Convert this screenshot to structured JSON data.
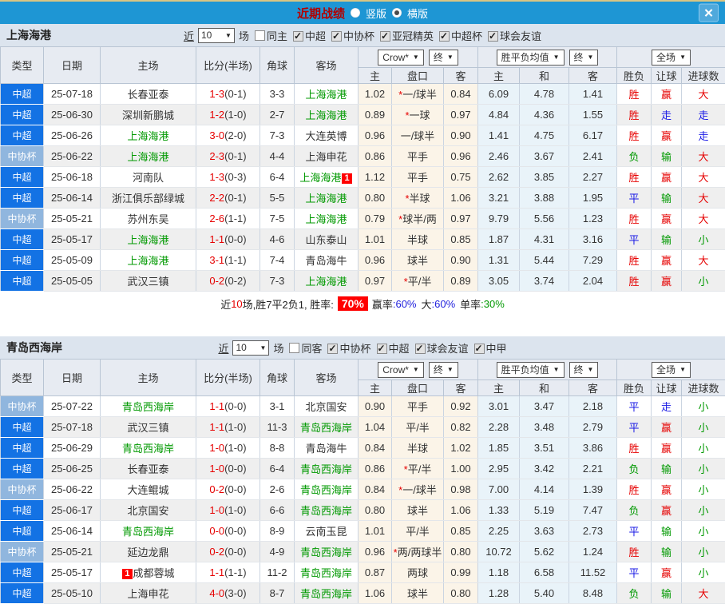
{
  "titlebar": {
    "title": "近期战绩",
    "view_options": [
      {
        "label": "竖版",
        "checked": false
      },
      {
        "label": "横版",
        "checked": true
      }
    ],
    "close_label": "✕"
  },
  "colors": {
    "titlebar_bg": "#1E96D4",
    "league_super_bg": "#1372E4",
    "league_cup_bg": "#90B6DE",
    "win_red": "#E60000",
    "draw_blue": "#1A1AE6",
    "lose_green": "#009900",
    "odds_col_bg": "#FBF4E8",
    "avg_col_bg": "#E9F3F9"
  },
  "header": {
    "columns": {
      "type": "类型",
      "date": "日期",
      "home": "主场",
      "score": "比分(半场)",
      "corner": "角球",
      "away": "客场"
    },
    "dropdowns": {
      "odds_company": "Crow*",
      "odds_final": "终",
      "avg": "胜平负均值",
      "avg_final": "终",
      "fulltime": "全场"
    },
    "sub": {
      "odds_home": "主",
      "handicap": "盘口",
      "odds_away": "客",
      "avg_home": "主",
      "avg_draw": "和",
      "avg_away": "客",
      "result": "胜负",
      "handicap_result": "让球",
      "goals": "进球数"
    }
  },
  "sections": [
    {
      "team": "上海海港",
      "filter": {
        "near": "近",
        "count": "10",
        "unit": "场",
        "same_label": "同主",
        "same_checked": false,
        "leagues": [
          {
            "label": "中超",
            "checked": true
          },
          {
            "label": "中协杯",
            "checked": true
          },
          {
            "label": "亚冠精英",
            "checked": true
          },
          {
            "label": "中超杯",
            "checked": true
          },
          {
            "label": "球会友谊",
            "checked": true
          }
        ]
      },
      "rows": [
        {
          "type": "中超",
          "tone": "strong",
          "date": "25-07-18",
          "home": "长春亚泰",
          "home_c": "dark",
          "hb": "",
          "score": "1-3",
          "half": "(0-1)",
          "corner": "3-3",
          "away": "上海海港",
          "away_c": "green",
          "ab": "",
          "oh": "1.02",
          "star": "*",
          "hcap": "一/球半",
          "oa": "0.84",
          "eh": "6.09",
          "ed": "4.78",
          "ea": "1.41",
          "res": "胜",
          "res_c": "red",
          "hres": "赢",
          "hres_c": "red",
          "goal": "大",
          "goal_c": "red"
        },
        {
          "type": "中超",
          "tone": "strong",
          "date": "25-06-30",
          "home": "深圳新鹏城",
          "home_c": "dark",
          "hb": "",
          "score": "1-2",
          "half": "(1-0)",
          "corner": "2-7",
          "away": "上海海港",
          "away_c": "green",
          "ab": "",
          "oh": "0.89",
          "star": "*",
          "hcap": "一球",
          "oa": "0.97",
          "eh": "4.84",
          "ed": "4.36",
          "ea": "1.55",
          "res": "胜",
          "res_c": "red",
          "hres": "走",
          "hres_c": "blue",
          "goal": "走",
          "goal_c": "blue"
        },
        {
          "type": "中超",
          "tone": "strong",
          "date": "25-06-26",
          "home": "上海海港",
          "home_c": "green",
          "hb": "",
          "score": "3-0",
          "half": "(2-0)",
          "corner": "7-3",
          "away": "大连英博",
          "away_c": "dark",
          "ab": "",
          "oh": "0.96",
          "star": "",
          "hcap": "一/球半",
          "oa": "0.90",
          "eh": "1.41",
          "ed": "4.75",
          "ea": "6.17",
          "res": "胜",
          "res_c": "red",
          "hres": "赢",
          "hres_c": "red",
          "goal": "走",
          "goal_c": "blue"
        },
        {
          "type": "中协杯",
          "tone": "light",
          "date": "25-06-22",
          "home": "上海海港",
          "home_c": "green",
          "hb": "",
          "score": "2-3",
          "half": "(0-1)",
          "corner": "4-4",
          "away": "上海申花",
          "away_c": "dark",
          "ab": "",
          "oh": "0.86",
          "star": "",
          "hcap": "平手",
          "oa": "0.96",
          "eh": "2.46",
          "ed": "3.67",
          "ea": "2.41",
          "res": "负",
          "res_c": "green",
          "hres": "输",
          "hres_c": "green",
          "goal": "大",
          "goal_c": "red"
        },
        {
          "type": "中超",
          "tone": "strong",
          "date": "25-06-18",
          "home": "河南队",
          "home_c": "dark",
          "hb": "",
          "score": "1-3",
          "half": "(0-3)",
          "corner": "6-4",
          "away": "上海海港",
          "away_c": "green",
          "ab": "1",
          "oh": "1.12",
          "star": "",
          "hcap": "平手",
          "oa": "0.75",
          "eh": "2.62",
          "ed": "3.85",
          "ea": "2.27",
          "res": "胜",
          "res_c": "red",
          "hres": "赢",
          "hres_c": "red",
          "goal": "大",
          "goal_c": "red"
        },
        {
          "type": "中超",
          "tone": "strong",
          "date": "25-06-14",
          "home": "浙江俱乐部绿城",
          "home_c": "dark",
          "hb": "",
          "score": "2-2",
          "half": "(0-1)",
          "corner": "5-5",
          "away": "上海海港",
          "away_c": "green",
          "ab": "",
          "oh": "0.80",
          "star": "*",
          "hcap": "半球",
          "oa": "1.06",
          "eh": "3.21",
          "ed": "3.88",
          "ea": "1.95",
          "res": "平",
          "res_c": "blue",
          "hres": "输",
          "hres_c": "green",
          "goal": "大",
          "goal_c": "red"
        },
        {
          "type": "中协杯",
          "tone": "light",
          "date": "25-05-21",
          "home": "苏州东吴",
          "home_c": "dark",
          "hb": "",
          "score": "2-6",
          "half": "(1-1)",
          "corner": "7-5",
          "away": "上海海港",
          "away_c": "green",
          "ab": "",
          "oh": "0.79",
          "star": "*",
          "hcap": "球半/两",
          "oa": "0.97",
          "eh": "9.79",
          "ed": "5.56",
          "ea": "1.23",
          "res": "胜",
          "res_c": "red",
          "hres": "赢",
          "hres_c": "red",
          "goal": "大",
          "goal_c": "red"
        },
        {
          "type": "中超",
          "tone": "strong",
          "date": "25-05-17",
          "home": "上海海港",
          "home_c": "green",
          "hb": "",
          "score": "1-1",
          "half": "(0-0)",
          "corner": "4-6",
          "away": "山东泰山",
          "away_c": "dark",
          "ab": "",
          "oh": "1.01",
          "star": "",
          "hcap": "半球",
          "oa": "0.85",
          "eh": "1.87",
          "ed": "4.31",
          "ea": "3.16",
          "res": "平",
          "res_c": "blue",
          "hres": "输",
          "hres_c": "green",
          "goal": "小",
          "goal_c": "green"
        },
        {
          "type": "中超",
          "tone": "strong",
          "date": "25-05-09",
          "home": "上海海港",
          "home_c": "green",
          "hb": "",
          "score": "3-1",
          "half": "(1-1)",
          "corner": "7-4",
          "away": "青岛海牛",
          "away_c": "dark",
          "ab": "",
          "oh": "0.96",
          "star": "",
          "hcap": "球半",
          "oa": "0.90",
          "eh": "1.31",
          "ed": "5.44",
          "ea": "7.29",
          "res": "胜",
          "res_c": "red",
          "hres": "赢",
          "hres_c": "red",
          "goal": "大",
          "goal_c": "red"
        },
        {
          "type": "中超",
          "tone": "strong",
          "date": "25-05-05",
          "home": "武汉三镇",
          "home_c": "dark",
          "hb": "",
          "score": "0-2",
          "half": "(0-2)",
          "corner": "7-3",
          "away": "上海海港",
          "away_c": "green",
          "ab": "",
          "oh": "0.97",
          "star": "*",
          "hcap": "平/半",
          "oa": "0.89",
          "eh": "3.05",
          "ed": "3.74",
          "ea": "2.04",
          "res": "胜",
          "res_c": "red",
          "hres": "赢",
          "hres_c": "red",
          "goal": "小",
          "goal_c": "green"
        }
      ],
      "summary": {
        "prefix": "近",
        "count": "10",
        "middle": "场,胜7平2负1, 胜率:",
        "win_rate": "70%",
        "label_win": "赢率",
        "val_win": ":60%",
        "label_big": "大",
        "val_big": ":60%",
        "label_single": "单率",
        "val_single": ":30%"
      }
    },
    {
      "team": "青岛西海岸",
      "filter": {
        "near": "近",
        "count": "10",
        "unit": "场",
        "same_label": "同客",
        "same_checked": false,
        "leagues": [
          {
            "label": "中协杯",
            "checked": true
          },
          {
            "label": "中超",
            "checked": true
          },
          {
            "label": "球会友谊",
            "checked": true
          },
          {
            "label": "中甲",
            "checked": true
          }
        ]
      },
      "rows": [
        {
          "type": "中协杯",
          "tone": "light",
          "date": "25-07-22",
          "home": "青岛西海岸",
          "home_c": "green",
          "hb": "",
          "score": "1-1",
          "half": "(0-0)",
          "corner": "3-1",
          "away": "北京国安",
          "away_c": "dark",
          "ab": "",
          "oh": "0.90",
          "star": "",
          "hcap": "平手",
          "oa": "0.92",
          "eh": "3.01",
          "ed": "3.47",
          "ea": "2.18",
          "res": "平",
          "res_c": "blue",
          "hres": "走",
          "hres_c": "blue",
          "goal": "小",
          "goal_c": "green"
        },
        {
          "type": "中超",
          "tone": "strong",
          "date": "25-07-18",
          "home": "武汉三镇",
          "home_c": "dark",
          "hb": "",
          "score": "1-1",
          "half": "(1-0)",
          "corner": "11-3",
          "away": "青岛西海岸",
          "away_c": "green",
          "ab": "",
          "oh": "1.04",
          "star": "",
          "hcap": "平/半",
          "oa": "0.82",
          "eh": "2.28",
          "ed": "3.48",
          "ea": "2.79",
          "res": "平",
          "res_c": "blue",
          "hres": "赢",
          "hres_c": "red",
          "goal": "小",
          "goal_c": "green"
        },
        {
          "type": "中超",
          "tone": "strong",
          "date": "25-06-29",
          "home": "青岛西海岸",
          "home_c": "green",
          "hb": "",
          "score": "1-0",
          "half": "(1-0)",
          "corner": "8-8",
          "away": "青岛海牛",
          "away_c": "dark",
          "ab": "",
          "oh": "0.84",
          "star": "",
          "hcap": "半球",
          "oa": "1.02",
          "eh": "1.85",
          "ed": "3.51",
          "ea": "3.86",
          "res": "胜",
          "res_c": "red",
          "hres": "赢",
          "hres_c": "red",
          "goal": "小",
          "goal_c": "green"
        },
        {
          "type": "中超",
          "tone": "strong",
          "date": "25-06-25",
          "home": "长春亚泰",
          "home_c": "dark",
          "hb": "",
          "score": "1-0",
          "half": "(0-0)",
          "corner": "6-4",
          "away": "青岛西海岸",
          "away_c": "green",
          "ab": "",
          "oh": "0.86",
          "star": "*",
          "hcap": "平/半",
          "oa": "1.00",
          "eh": "2.95",
          "ed": "3.42",
          "ea": "2.21",
          "res": "负",
          "res_c": "green",
          "hres": "输",
          "hres_c": "green",
          "goal": "小",
          "goal_c": "green"
        },
        {
          "type": "中协杯",
          "tone": "light",
          "date": "25-06-22",
          "home": "大连鲲城",
          "home_c": "dark",
          "hb": "",
          "score": "0-2",
          "half": "(0-0)",
          "corner": "2-6",
          "away": "青岛西海岸",
          "away_c": "green",
          "ab": "",
          "oh": "0.84",
          "star": "*",
          "hcap": "一/球半",
          "oa": "0.98",
          "eh": "7.00",
          "ed": "4.14",
          "ea": "1.39",
          "res": "胜",
          "res_c": "red",
          "hres": "赢",
          "hres_c": "red",
          "goal": "小",
          "goal_c": "green"
        },
        {
          "type": "中超",
          "tone": "strong",
          "date": "25-06-17",
          "home": "北京国安",
          "home_c": "dark",
          "hb": "",
          "score": "1-0",
          "half": "(1-0)",
          "corner": "6-6",
          "away": "青岛西海岸",
          "away_c": "green",
          "ab": "",
          "oh": "0.80",
          "star": "",
          "hcap": "球半",
          "oa": "1.06",
          "eh": "1.33",
          "ed": "5.19",
          "ea": "7.47",
          "res": "负",
          "res_c": "green",
          "hres": "赢",
          "hres_c": "red",
          "goal": "小",
          "goal_c": "green"
        },
        {
          "type": "中超",
          "tone": "strong",
          "date": "25-06-14",
          "home": "青岛西海岸",
          "home_c": "green",
          "hb": "",
          "score": "0-0",
          "half": "(0-0)",
          "corner": "8-9",
          "away": "云南玉昆",
          "away_c": "dark",
          "ab": "",
          "oh": "1.01",
          "star": "",
          "hcap": "平/半",
          "oa": "0.85",
          "eh": "2.25",
          "ed": "3.63",
          "ea": "2.73",
          "res": "平",
          "res_c": "blue",
          "hres": "输",
          "hres_c": "green",
          "goal": "小",
          "goal_c": "green"
        },
        {
          "type": "中协杯",
          "tone": "light",
          "date": "25-05-21",
          "home": "延边龙鼎",
          "home_c": "dark",
          "hb": "",
          "score": "0-2",
          "half": "(0-0)",
          "corner": "4-9",
          "away": "青岛西海岸",
          "away_c": "green",
          "ab": "",
          "oh": "0.96",
          "star": "*",
          "hcap": "两/两球半",
          "oa": "0.80",
          "eh": "10.72",
          "ed": "5.62",
          "ea": "1.24",
          "res": "胜",
          "res_c": "red",
          "hres": "输",
          "hres_c": "green",
          "goal": "小",
          "goal_c": "green"
        },
        {
          "type": "中超",
          "tone": "strong",
          "date": "25-05-17",
          "home": "成都蓉城",
          "home_c": "dark",
          "hb": "1",
          "score": "1-1",
          "half": "(1-1)",
          "corner": "11-2",
          "away": "青岛西海岸",
          "away_c": "green",
          "ab": "",
          "oh": "0.87",
          "star": "",
          "hcap": "两球",
          "oa": "0.99",
          "eh": "1.18",
          "ed": "6.58",
          "ea": "11.52",
          "res": "平",
          "res_c": "blue",
          "hres": "赢",
          "hres_c": "red",
          "goal": "小",
          "goal_c": "green"
        },
        {
          "type": "中超",
          "tone": "strong",
          "date": "25-05-10",
          "home": "上海申花",
          "home_c": "dark",
          "hb": "",
          "score": "4-0",
          "half": "(3-0)",
          "corner": "8-7",
          "away": "青岛西海岸",
          "away_c": "green",
          "ab": "",
          "oh": "1.06",
          "star": "",
          "hcap": "球半",
          "oa": "0.80",
          "eh": "1.28",
          "ed": "5.40",
          "ea": "8.48",
          "res": "负",
          "res_c": "green",
          "hres": "输",
          "hres_c": "green",
          "goal": "大",
          "goal_c": "red"
        }
      ]
    }
  ]
}
